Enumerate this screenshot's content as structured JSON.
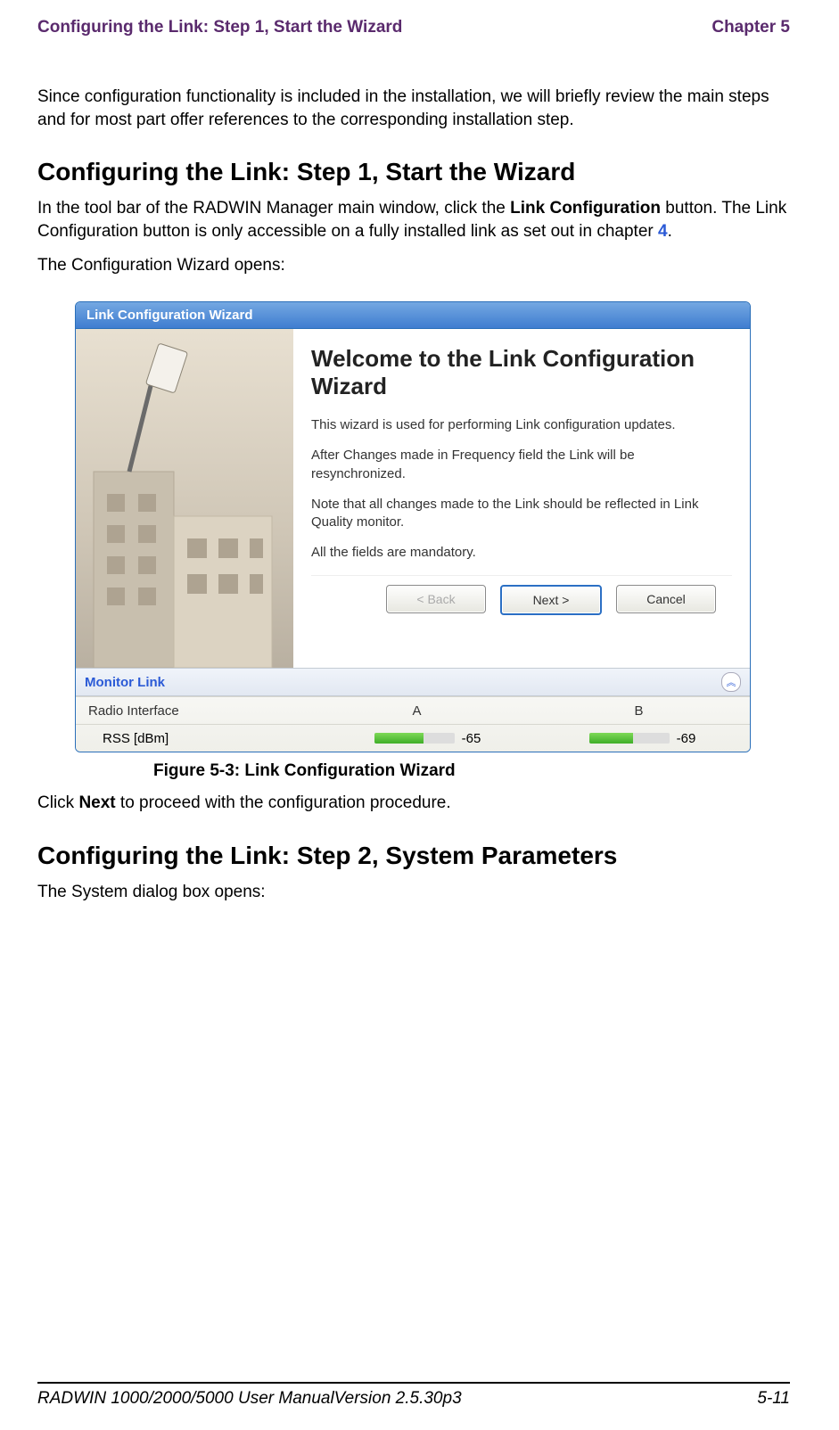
{
  "header": {
    "left": "Configuring the Link: Step 1, Start the Wizard",
    "right": "Chapter 5"
  },
  "intro": "Since configuration functionality is included in the installation, we will briefly review the main steps and for most part offer references to the corresponding installation step.",
  "section1": {
    "heading": "Configuring the Link: Step 1, Start the Wizard",
    "p1a": "In the tool bar of the RADWIN Manager main window, click the ",
    "p1b": "Link Configuration",
    "p1c": " button. The Link Configuration button is only accessible on a fully installed link as set out in chapter ",
    "p1link": "4",
    "p1d": ".",
    "p2": "The Configuration Wizard opens:"
  },
  "wizard": {
    "titlebar": "Link Configuration Wizard",
    "welcome": "Welcome to the Link Configuration Wizard",
    "line1": "This wizard is used for performing Link configuration updates.",
    "line2": "After Changes made in Frequency field the Link will be resynchronized.",
    "line3": "Note that all changes made to the Link should be reflected in Link Quality monitor.",
    "line4": "All the fields are mandatory.",
    "buttons": {
      "back": "< Back",
      "next": "Next >",
      "cancel": "Cancel"
    },
    "monitor": {
      "label": "Monitor Link",
      "row_header": "Radio Interface",
      "colA": "A",
      "colB": "B",
      "rss_label": "RSS [dBm]",
      "rssA": "-65",
      "rssB": "-69"
    }
  },
  "figure_caption": "Figure 5-3: Link Configuration Wizard",
  "after_fig": {
    "p1a": "Click ",
    "p1b": "Next",
    "p1c": " to proceed with the configuration procedure."
  },
  "section2": {
    "heading": "Configuring the Link: Step 2, System Parameters",
    "p1": "The System dialog box opens:"
  },
  "footer": {
    "left": "RADWIN 1000/2000/5000 User ManualVersion  2.5.30p3",
    "right": "5-11"
  }
}
